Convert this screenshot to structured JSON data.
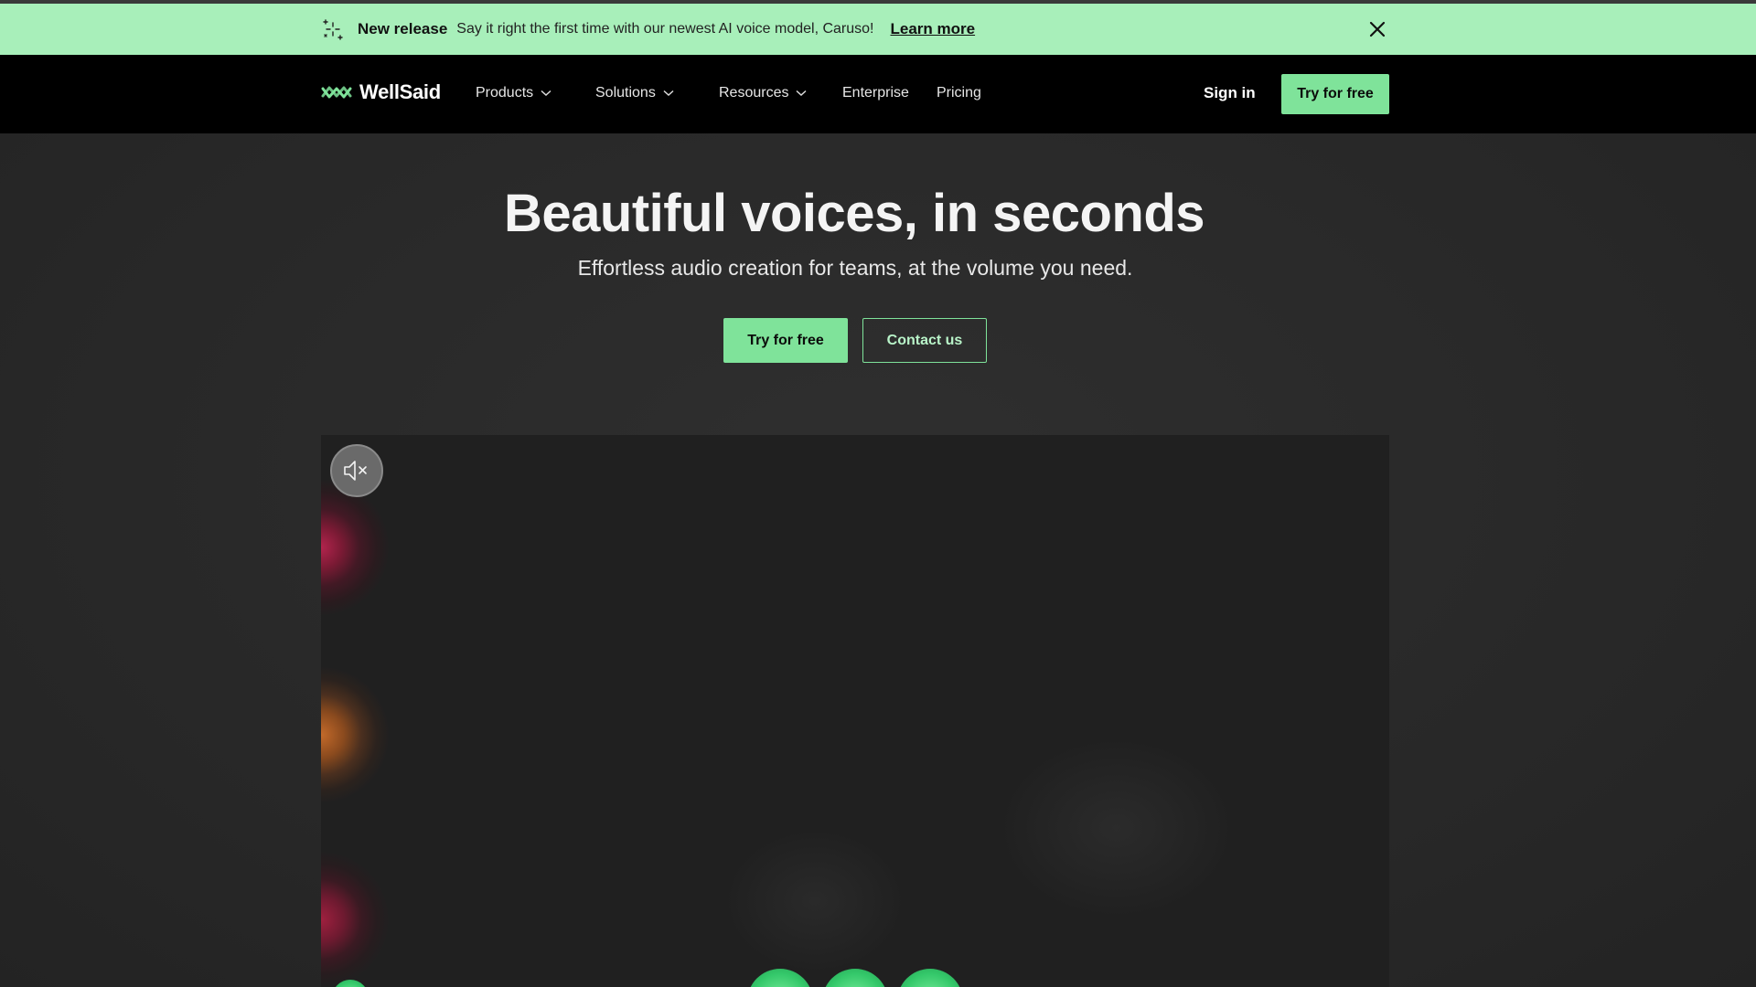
{
  "announcement": {
    "title": "New release",
    "message": "Say it right the first time with our newest AI voice model, Caruso!",
    "link": "Learn more"
  },
  "nav": {
    "brand": "WellSaid",
    "items": [
      {
        "label": "Products",
        "dropdown": true
      },
      {
        "label": "Solutions",
        "dropdown": true
      },
      {
        "label": "Resources",
        "dropdown": true
      },
      {
        "label": "Enterprise",
        "dropdown": false
      },
      {
        "label": "Pricing",
        "dropdown": false
      }
    ],
    "sign_in": "Sign in",
    "cta": "Try for free"
  },
  "hero": {
    "title": "Beautiful voices, in seconds",
    "subtitle": "Effortless audio creation for teams, at the volume you need.",
    "primary_button": "Try for free",
    "secondary_button": "Contact us"
  },
  "colors": {
    "accent": "#7fe39a",
    "announcement_bg": "#a8efba",
    "nav_bg": "#000000",
    "page_bg": "#2b2b2b"
  }
}
